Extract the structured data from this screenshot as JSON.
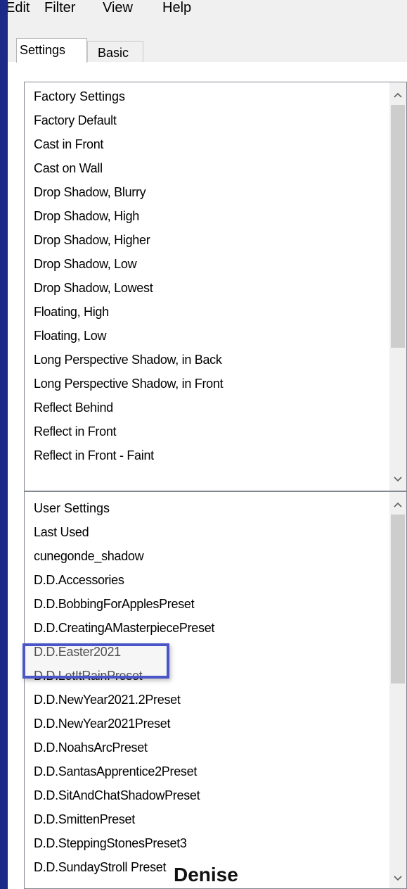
{
  "menu": {
    "items": [
      "Edit",
      "Filter",
      "View",
      "Help"
    ]
  },
  "tabs": [
    {
      "label": "Settings"
    },
    {
      "label": "Basic"
    }
  ],
  "factory": {
    "header": "Factory Settings",
    "items": [
      "Factory Default",
      "Cast in Front",
      "Cast on Wall",
      "Drop Shadow, Blurry",
      "Drop Shadow, High",
      "Drop Shadow, Higher",
      "Drop Shadow, Low",
      "Drop Shadow, Lowest",
      "Floating, High",
      "Floating, Low",
      "Long Perspective Shadow, in Back",
      "Long Perspective Shadow, in Front",
      "Reflect Behind",
      "Reflect in Front",
      "Reflect in Front - Faint"
    ]
  },
  "user": {
    "header": "User Settings",
    "items": [
      "Last Used",
      "cunegonde_shadow",
      "D.D.Accessories",
      "D.D.BobbingForApplesPreset",
      "D.D.CreatingAMasterpiecePreset",
      "D.D.Easter2021",
      "D.D.LetItRainPreset",
      "D.D.NewYear2021.2Preset",
      "D.D.NewYear2021Preset",
      "D.D.NoahsArcPreset",
      "D.D.SantasApprentice2Preset",
      "D.D.SitAndChatShadowPreset",
      "D.D.SmittenPreset",
      "D.D.SteppingStonesPreset3",
      "D.D.SundayStroll Preset"
    ],
    "highlighted": "D.D.Easter2021"
  },
  "icons": {
    "scroll_up": "chevron-up-icon",
    "scroll_down": "chevron-down-icon"
  },
  "colors": {
    "highlight_border": "#4a56c7",
    "window_frame": "#1a2a86"
  },
  "watermark": "Denise"
}
